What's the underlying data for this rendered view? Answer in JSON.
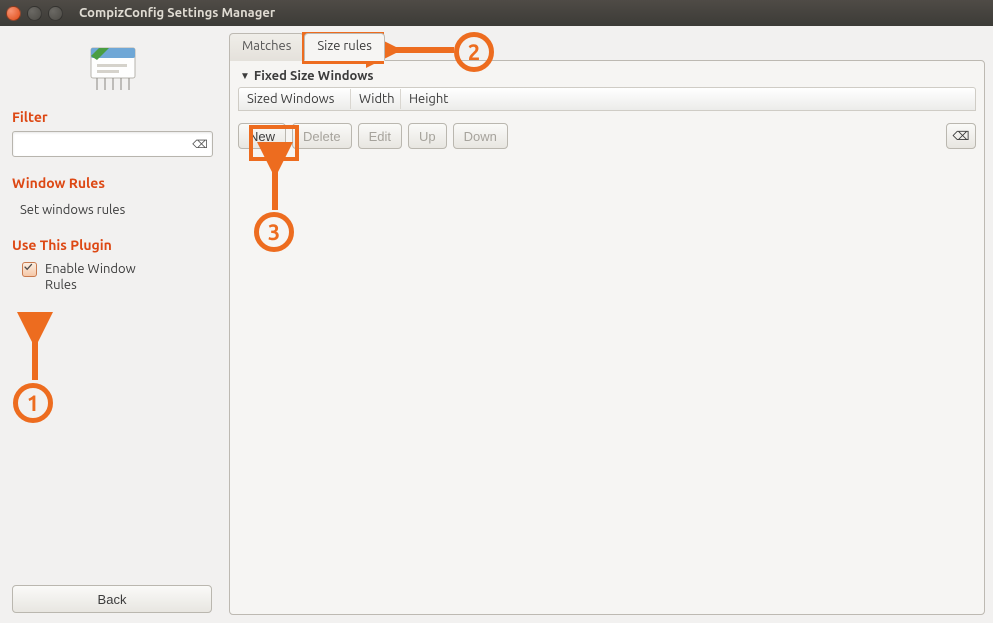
{
  "window": {
    "title": "CompizConfig Settings Manager"
  },
  "sidebar": {
    "filter_label": "Filter",
    "filter_value": "",
    "filter_placeholder": "",
    "section_rules": "Window Rules",
    "link_set_rules": "Set windows rules",
    "section_use_plugin": "Use This Plugin",
    "enable_label": "Enable Window Rules",
    "back": "Back"
  },
  "tabs": {
    "matches": "Matches",
    "size_rules": "Size rules",
    "active": "size_rules"
  },
  "group": {
    "title": "Fixed Size Windows",
    "cols": {
      "c0": "Sized Windows",
      "c1": "Width",
      "c2": "Height"
    }
  },
  "buttons": {
    "new_": "New",
    "delete_": "Delete",
    "edit_": "Edit",
    "up_": "Up",
    "down_": "Down"
  },
  "annotations": {
    "n1": "1",
    "n2": "2",
    "n3": "3"
  },
  "colors": {
    "accent": "#dd4814",
    "annot": "#ed6c1f"
  }
}
